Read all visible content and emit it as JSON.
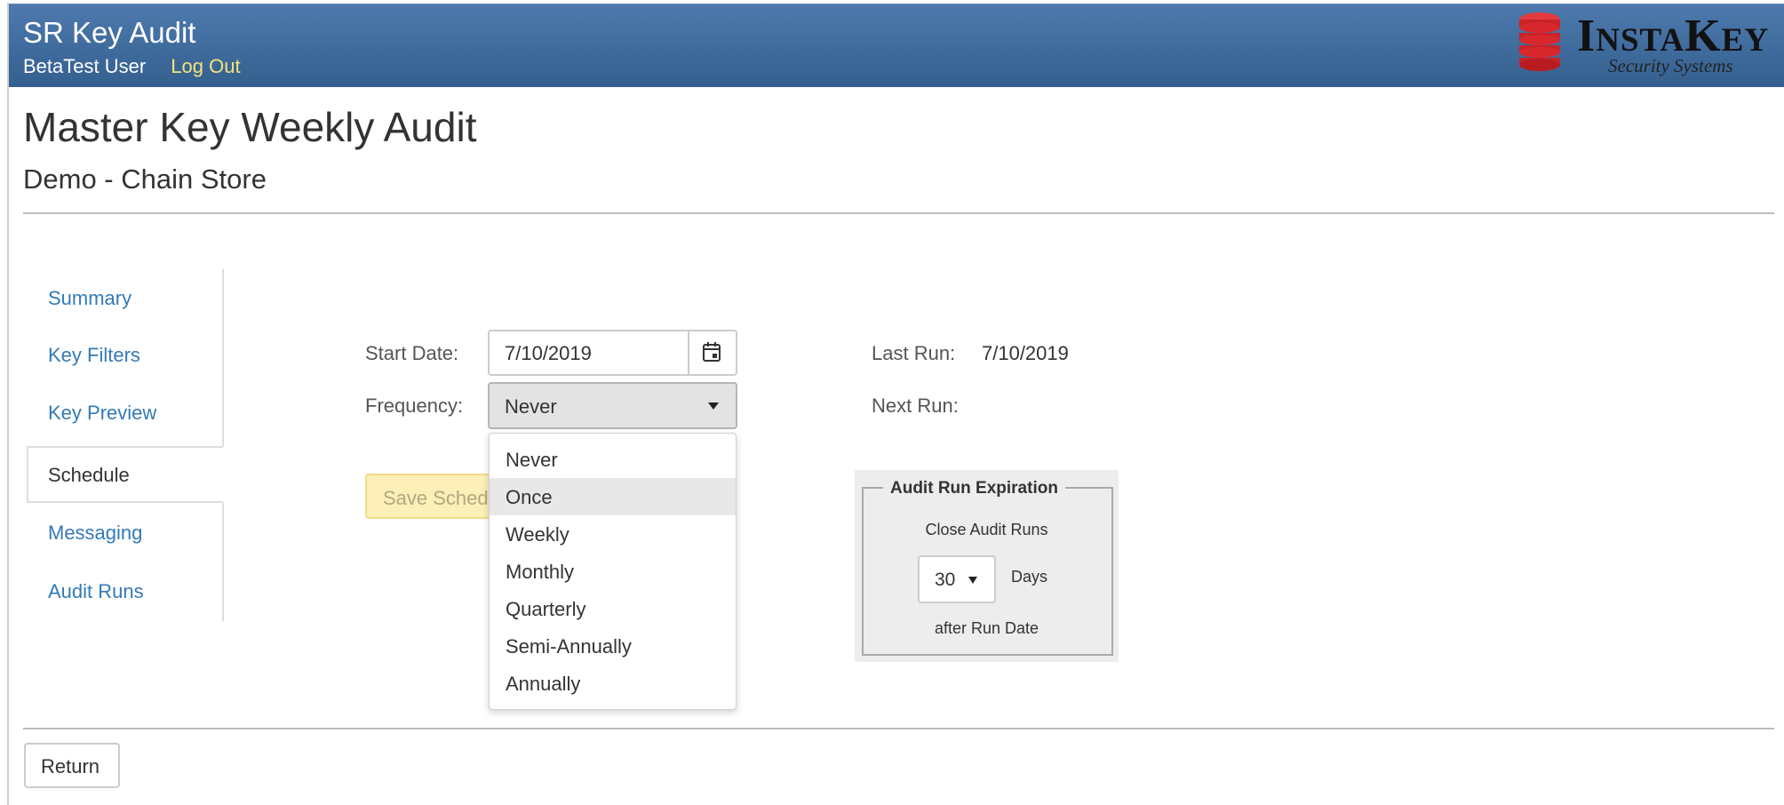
{
  "header": {
    "app_title": "SR Key Audit",
    "user_name": "BetaTest User",
    "logout_label": "Log Out",
    "logo_text_big_i": "I",
    "logo_text_nsta": "NSTA",
    "logo_text_big_k": "K",
    "logo_text_ey": "EY",
    "logo_tagline": "Security Systems",
    "colors": {
      "bar": "#3e6a9c",
      "logout": "#f6e27a",
      "logo_disk": "#d8282e"
    }
  },
  "page": {
    "title": "Master Key Weekly Audit",
    "subtitle": "Demo - Chain Store"
  },
  "sidebar": {
    "items": [
      {
        "label": "Summary",
        "active": false
      },
      {
        "label": "Key Filters",
        "active": false
      },
      {
        "label": "Key Preview",
        "active": false
      },
      {
        "label": "Schedule",
        "active": true
      },
      {
        "label": "Messaging",
        "active": false
      },
      {
        "label": "Audit Runs",
        "active": false
      }
    ]
  },
  "schedule": {
    "start_date_label": "Start Date:",
    "start_date_value": "7/10/2019",
    "calendar_icon": "calendar-icon",
    "frequency_label": "Frequency:",
    "frequency_value": "Never",
    "frequency_options": [
      "Never",
      "Once",
      "Weekly",
      "Monthly",
      "Quarterly",
      "Semi-Annually",
      "Annually"
    ],
    "highlighted_option": "Once",
    "save_label": "Save Schedule",
    "last_run_label": "Last Run:",
    "last_run_value": "7/10/2019",
    "next_run_label": "Next Run:"
  },
  "expiration": {
    "legend": "Audit Run Expiration",
    "line1": "Close Audit Runs",
    "days_value": "30",
    "days_label": "Days",
    "line3": "after Run Date"
  },
  "footer": {
    "return_label": "Return"
  }
}
